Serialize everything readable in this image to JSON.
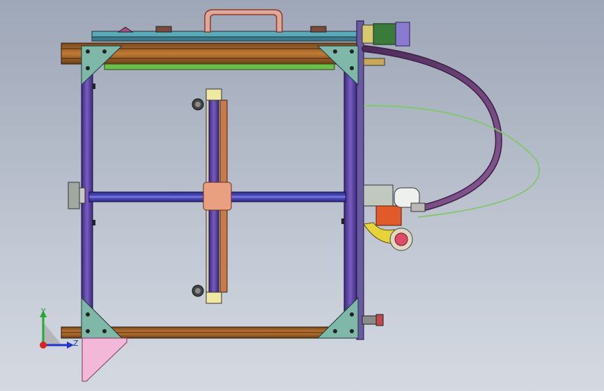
{
  "viewport": {
    "background_top": "#9ea7b8",
    "background_bottom": "#d4d9e1"
  },
  "model": {
    "frame_color": "#6a4fa6",
    "rail_color": "#b06a2a",
    "gusset_color": "#7fb8a8",
    "hose_color": "#6d3f79",
    "cable_color": "#7fc86a",
    "bracket_color": "#f3b8d8"
  },
  "triad": {
    "y_label": "Y",
    "z_label": "Z",
    "y_color": "#22aa33",
    "z_color": "#2233cc",
    "x_color": "#dd2222"
  }
}
